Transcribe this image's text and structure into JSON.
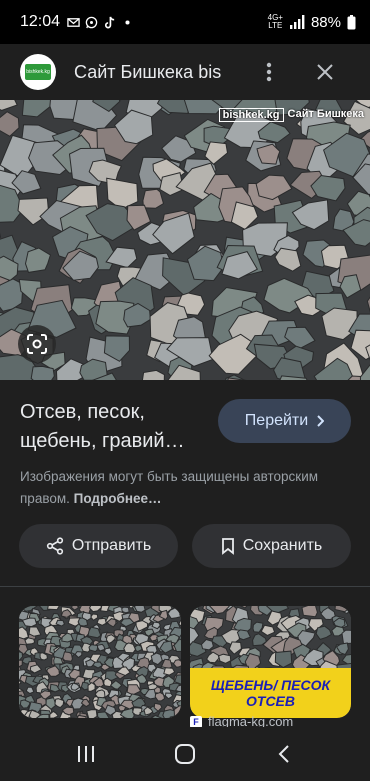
{
  "status_bar": {
    "time": "12:04",
    "network_label_top": "4G+",
    "network_label_bottom": "LTE",
    "battery": "88%",
    "icons": [
      "email-icon",
      "whatsapp-icon",
      "tiktok-icon",
      "dot-icon",
      "signal-icon",
      "battery-icon"
    ]
  },
  "header": {
    "site_name": "Сайт Бишкека bis",
    "logo_text": "bishkek.kg"
  },
  "image": {
    "watermark_left": "bishkek.kg",
    "watermark_right": "Сайт Бишкека"
  },
  "result": {
    "title": "Отсев, песок, щебень, гравий…",
    "go_label": "Перейти",
    "copyright_text": "Изображения могут быть защищены авторским правом. ",
    "more_link": "Подробнее…"
  },
  "actions": {
    "share_label": "Отправить",
    "save_label": "Сохранить"
  },
  "related": {
    "thumb2_banner_line1": "ЩЕБЕНЬ/ ПЕСОК",
    "thumb2_banner_line2": "ОТСЕВ",
    "thumb2_source": "flagma-kg.com",
    "thumb2_favicon": "F"
  },
  "colors": {
    "background": "#1f1f1f",
    "go_button": "#394457",
    "action_button": "#303134",
    "banner": "#f2d11b"
  }
}
